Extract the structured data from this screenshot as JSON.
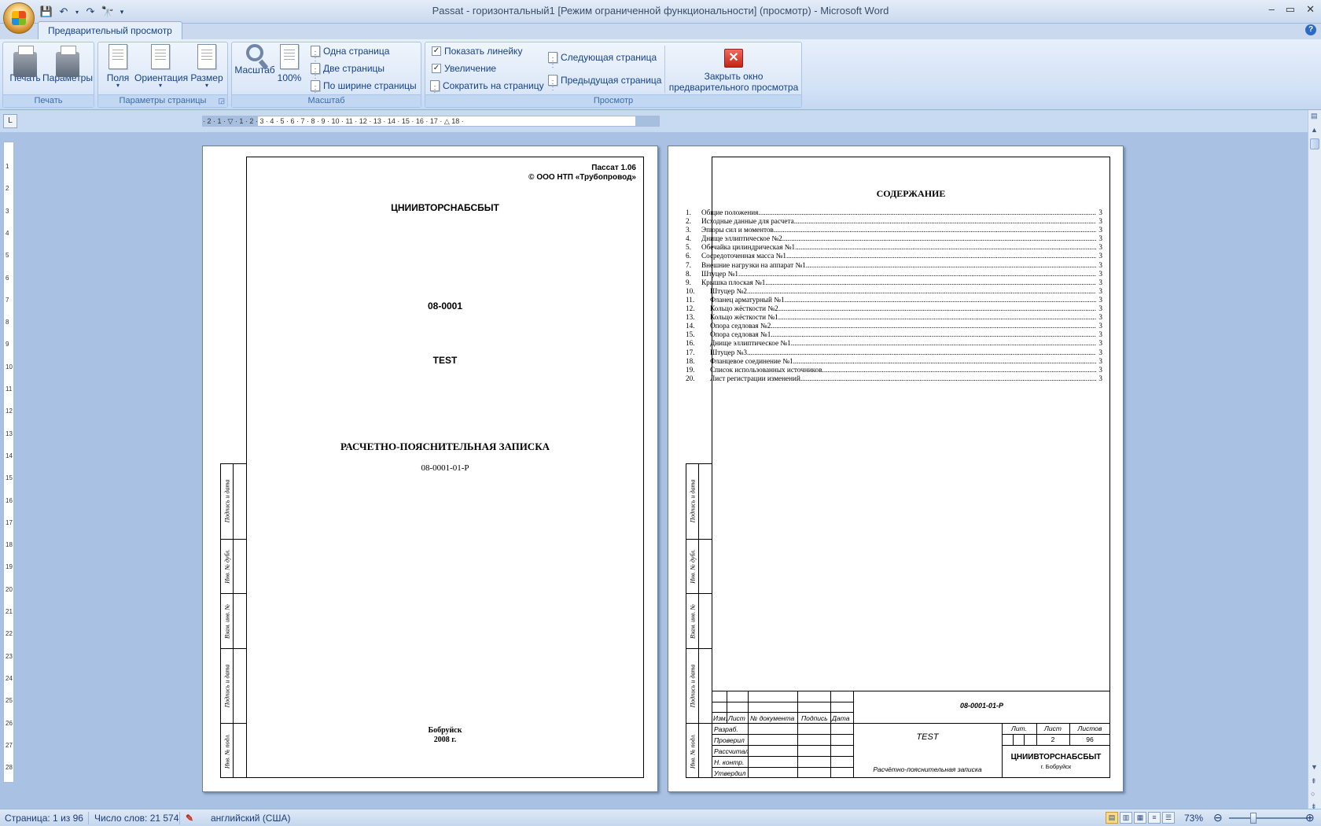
{
  "window": {
    "title": "Passat - горизонтальный1 [Режим ограниченной функциональности] (просмотр) - Microsoft Word",
    "controls": [
      "–",
      "▭",
      "✕"
    ]
  },
  "ribbon": {
    "active_tab": "Предварительный просмотр",
    "groups": {
      "print": {
        "title": "Печать",
        "buttons": {
          "print": "Печать",
          "options": "Параметры"
        }
      },
      "page_setup": {
        "title": "Параметры страницы",
        "buttons": {
          "margins": "Поля",
          "orientation": "Ориентация",
          "size": "Размер"
        }
      },
      "zoom": {
        "title": "Масштаб",
        "buttons": {
          "zoom": "Масштаб",
          "hundred": "100%",
          "one_page": "Одна страница",
          "two_pages": "Две страницы",
          "page_width": "По ширине страницы"
        }
      },
      "preview": {
        "title": "Просмотр",
        "show_ruler": "Показать линейку",
        "magnifier": "Увеличение",
        "shrink": "Сократить на страницу",
        "next_page": "Следующая страница",
        "prev_page": "Предыдущая страница",
        "close_line1": "Закрыть окно",
        "close_line2": "предварительного просмотра"
      }
    }
  },
  "ruler": {
    "h_ticks": "· 2 · 1 · ▽ · 1 · 2 · 3 · 4 · 5 · 6 · 7 · 8 · 9 · 10 · 11 · 12 · 13 · 14 · 15 · 16 · 17 · △ 18 ·",
    "v_ticks": [
      "1",
      "2",
      "3",
      "4",
      "5",
      "6",
      "7",
      "8",
      "9",
      "10",
      "11",
      "12",
      "13",
      "14",
      "15",
      "16",
      "17",
      "18",
      "19",
      "20",
      "21",
      "22",
      "23",
      "24",
      "25",
      "26",
      "27",
      "28"
    ]
  },
  "page1": {
    "header_line1": "Пассат 1.06",
    "header_line2": "© ООО НТП «Трубопровод»",
    "org": "ЦНИИВТОРСНАБСБЫТ",
    "code": "08-0001",
    "test": "TEST",
    "doc_title": "РАСЧЕТНО-ПОЯСНИТЕЛЬНАЯ ЗАПИСКА",
    "doc_code": "08-0001-01-Р",
    "city": "Бобруйск",
    "year": "2008 г.",
    "side_labels": [
      "Подпись и дата",
      "Инв. № дубл.",
      "Взам. инв. №",
      "Подпись и дата",
      "Инв. № подл."
    ]
  },
  "page2": {
    "toc_title": "СОДЕРЖАНИЕ",
    "toc": [
      {
        "n": "1.",
        "t": "Общие положения",
        "p": "3"
      },
      {
        "n": "2.",
        "t": "Исходные данные для расчета",
        "p": "3"
      },
      {
        "n": "3.",
        "t": "Эпюры сил и моментов",
        "p": "3"
      },
      {
        "n": "4.",
        "t": "Днище эллиптическое №2",
        "p": "3"
      },
      {
        "n": "5.",
        "t": "Обечайка цилиндрическая №1",
        "p": "3"
      },
      {
        "n": "6.",
        "t": "Сосредоточенная масса №1",
        "p": "3"
      },
      {
        "n": "7.",
        "t": "Внешние нагрузки на аппарат №1",
        "p": "3"
      },
      {
        "n": "8.",
        "t": "Штуцер №1",
        "p": "3"
      },
      {
        "n": "9.",
        "t": "Крышка плоская №1",
        "p": "3"
      },
      {
        "n": "10.",
        "t": "Штуцер №2",
        "p": "3"
      },
      {
        "n": "11.",
        "t": "Фланец арматурный №1",
        "p": "3"
      },
      {
        "n": "12.",
        "t": "Кольцо жёсткости №2",
        "p": "3"
      },
      {
        "n": "13.",
        "t": "Кольцо жёсткости №1",
        "p": "3"
      },
      {
        "n": "14.",
        "t": "Опора седловая №2",
        "p": "3"
      },
      {
        "n": "15.",
        "t": "Опора седловая №1",
        "p": "3"
      },
      {
        "n": "16.",
        "t": "Днище эллиптическое №1",
        "p": "3"
      },
      {
        "n": "17.",
        "t": "Штуцер №3",
        "p": "3"
      },
      {
        "n": "18.",
        "t": "Фланцевое соединение №1",
        "p": "3"
      },
      {
        "n": "19.",
        "t": "Список использованных источников",
        "p": "3"
      },
      {
        "n": "20.",
        "t": "Лист регистрации изменений",
        "p": "3"
      }
    ],
    "side_labels": [
      "Подпись и дата",
      "Инв. № дубл.",
      "Взам. инв. №",
      "Подпись и дата",
      "Инв. № подл."
    ],
    "stamp": {
      "doc_code": "08-0001-01-Р",
      "col_izm": "Изм.",
      "col_list": "Лист",
      "col_doc": "№ документа",
      "col_sign": "Подпись",
      "col_date": "Дата",
      "razrab": "Разраб.",
      "proveril": "Проверил",
      "rasschital": "Рассчитал",
      "n_kontr": "Н. контр.",
      "utverdil": "Утвердил",
      "test": "TEST",
      "doc_name": "Расчётно-пояснительная записка",
      "lit": "Лит.",
      "list": "Лист",
      "listov": "Листов",
      "list_val": "2",
      "listov_val": "96",
      "org": "ЦНИИВТОРСНАБСБЫТ",
      "city": "г. Бобруйск"
    }
  },
  "status": {
    "page": "Страница: 1 из 96",
    "words": "Число слов: 21 574",
    "lang": "английский (США)",
    "zoom": "73%"
  }
}
